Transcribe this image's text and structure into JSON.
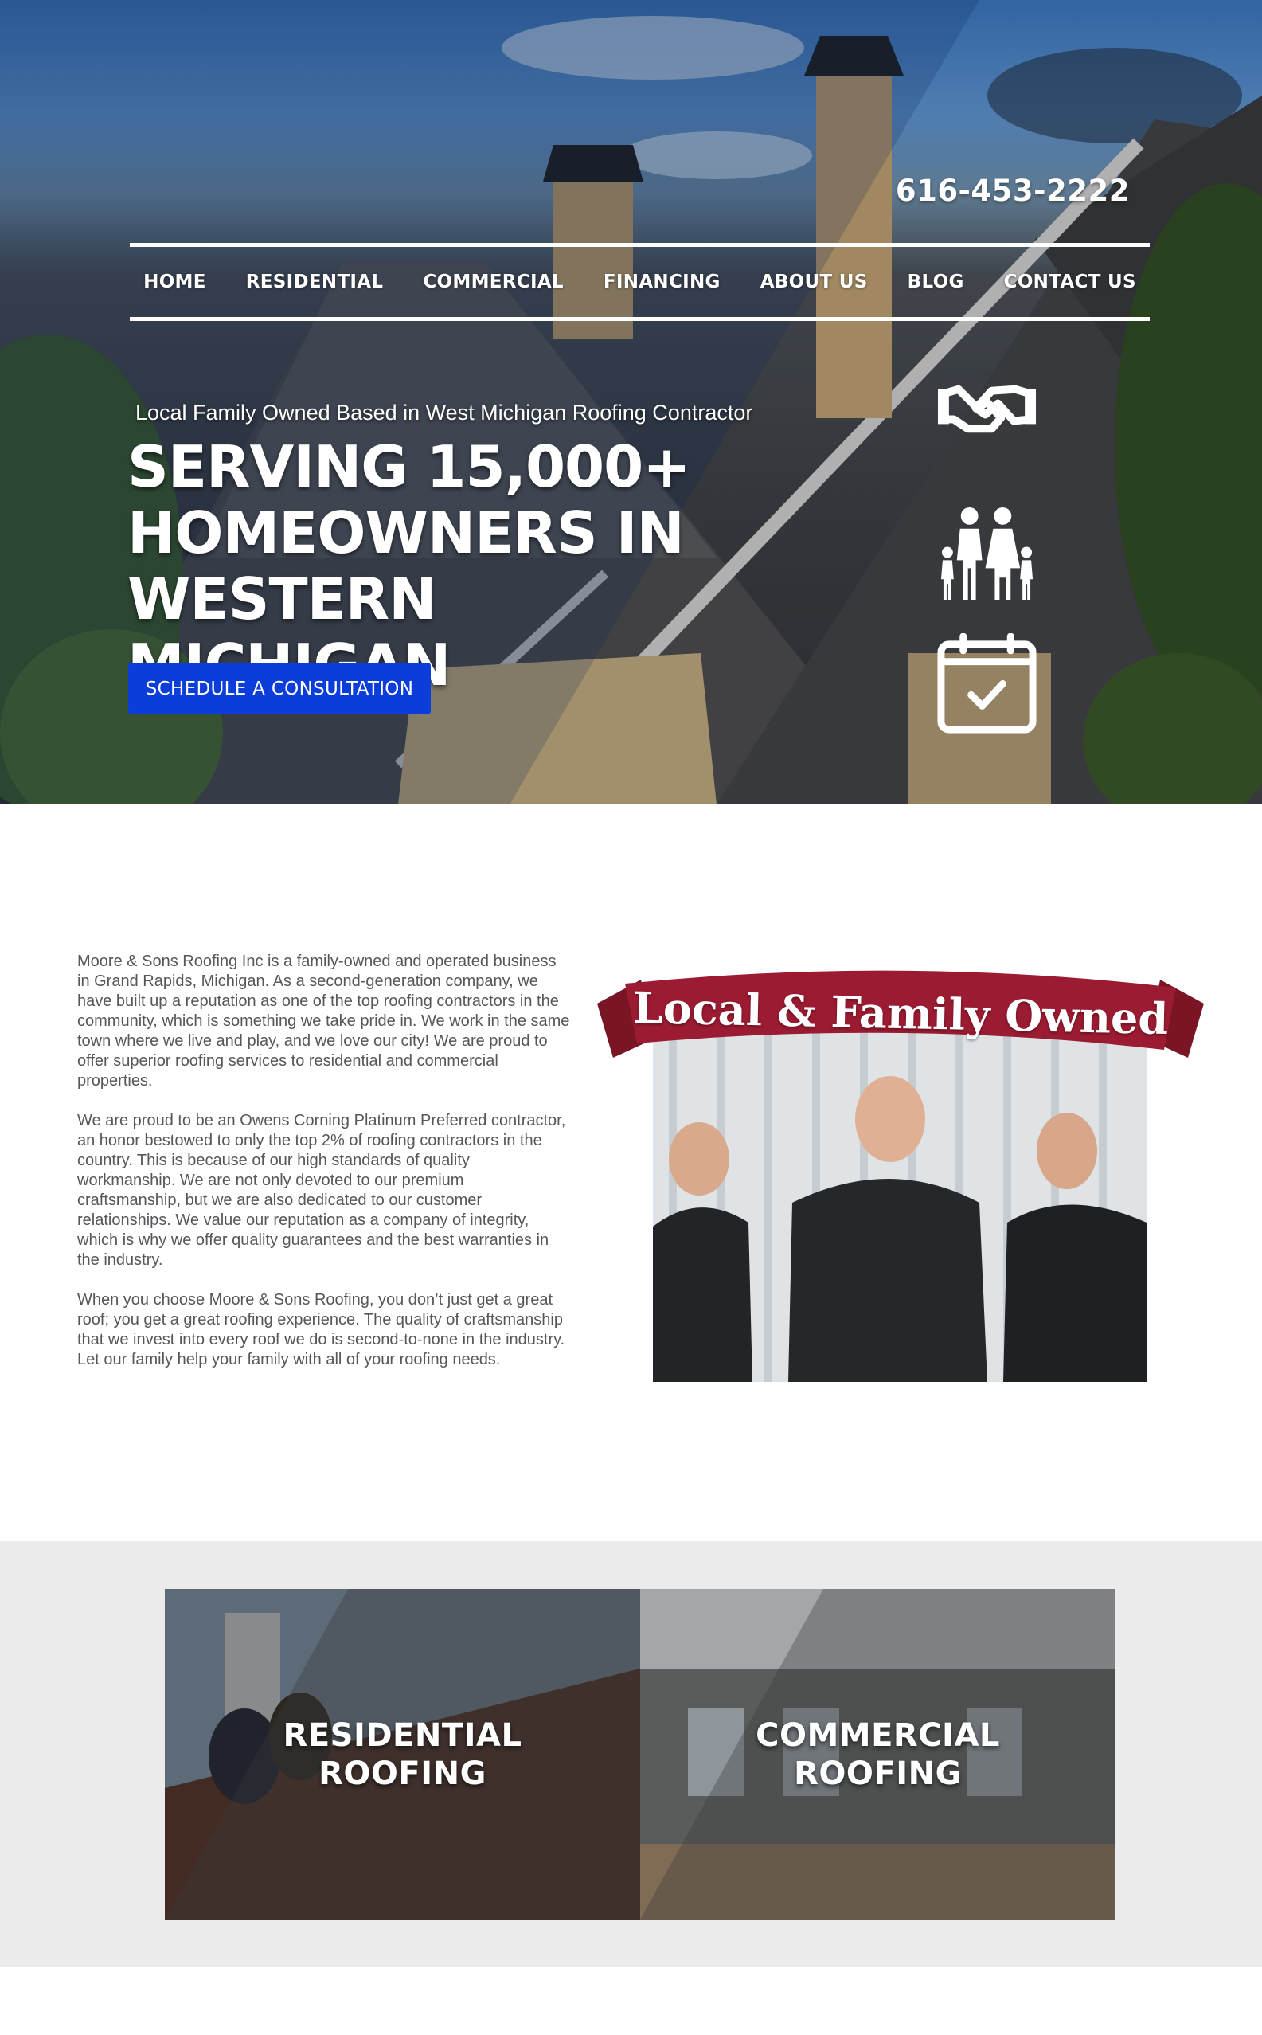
{
  "header": {
    "phone": "616-453-2222"
  },
  "nav": {
    "items": [
      {
        "label": "HOME"
      },
      {
        "label": "RESIDENTIAL"
      },
      {
        "label": "COMMERCIAL"
      },
      {
        "label": "FINANCING"
      },
      {
        "label": "ABOUT US"
      },
      {
        "label": "BLOG"
      },
      {
        "label": "CONTACT US"
      }
    ]
  },
  "hero": {
    "tagline": "Local Family Owned Based in West Michigan Roofing Contractor",
    "headline": "SERVING 15,000+ HOMEOWNERS IN WESTERN MICHIGAN",
    "cta_label": "SCHEDULE A CONSULTATION",
    "icons": [
      "handshake-icon",
      "family-icon",
      "calendar-check-icon"
    ]
  },
  "about": {
    "paragraphs": [
      "Moore & Sons Roofing Inc is a family-owned and operated business in Grand Rapids, Michigan. As a second-generation company, we have built up a reputation as one of the top roofing contractors in the community, which is something we take pride in. We work in the same town where we live and play, and we love our city! We are proud to offer superior roofing services to residential and commercial properties.",
      "We are proud to be an Owens Corning Platinum Preferred contractor, an honor bestowed to only the top 2% of roofing contractors in the country. This is because of our high standards of quality workmanship. We are not only devoted to our premium craftsmanship, but we are also dedicated to our customer relationships. We value our reputation as a company of integrity, which is why we offer quality guarantees and the best warranties in the industry.",
      "When you choose Moore & Sons Roofing, you don’t just get a great roof; you get a great roofing experience. The quality of craftsmanship that we invest into every roof we do is second-to-none in the industry. Let our family help your family with all of your roofing needs."
    ],
    "banner": "Local & Family Owned"
  },
  "services": {
    "residential": {
      "line1": "RESIDENTIAL",
      "line2": "ROOFING"
    },
    "commercial": {
      "line1": "COMMERCIAL",
      "line2": "ROOFING"
    }
  },
  "colors": {
    "cta": "#0b3ddb",
    "banner": "#9b1b32",
    "services_bg": "#ebebeb",
    "body_text": "#55575a"
  }
}
